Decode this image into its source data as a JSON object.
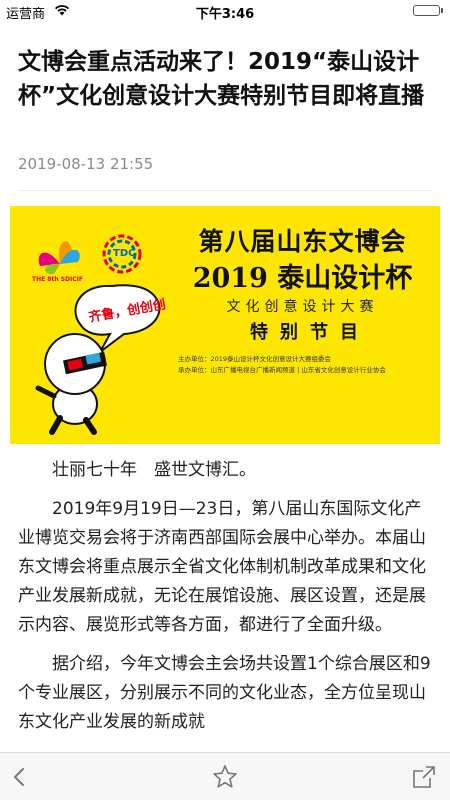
{
  "status_bar": {
    "carrier": "运营商",
    "time": "下午3:46",
    "battery_level": 1.0
  },
  "article": {
    "title": "文博会重点活动来了！2019“泰山设计杯”文化创意设计大赛特别节目即将直播",
    "date": "2019-08-13 21:55",
    "paragraphs": [
      "壮丽七十年　盛世文博汇。",
      "2019年9月19日—23日，第八届山东国际文化产业博览交易会将于济南西部国际会展中心举办。本届山东文博会将重点展示全省文化体制机制改革成果和文化产业发展新成就，无论在展馆设施、展区设置，还是展示内容、展览形式等各方面，都进行了全面升级。",
      "据介绍，今年文博会主会场共设置1个综合展区和9个专业展区，分别展示不同的文化业态，全方位呈现山东文化产业发展的新成就"
    ]
  },
  "banner": {
    "logo1_text": "THE 8th SDICIF",
    "logo2_text": "TDC",
    "main_title": "第八届山东文博会",
    "sub_title": "2019 泰山设计杯",
    "competition": "文化创意设计大赛",
    "special": "特别节目",
    "organizer": "主办单位：2019泰山设计杯文化创意设计大赛组委会",
    "co_organizer": "承办单位：山东广播电视台广播新闻频道 | 山东省文化创意设计行业协会",
    "bubble_text": "齐鲁，创创创",
    "colors": {
      "background": "#ffe600"
    }
  },
  "toolbar": {
    "back_icon": "chevron-left-icon",
    "favorite_icon": "star-outline-icon",
    "share_icon": "share-icon"
  }
}
